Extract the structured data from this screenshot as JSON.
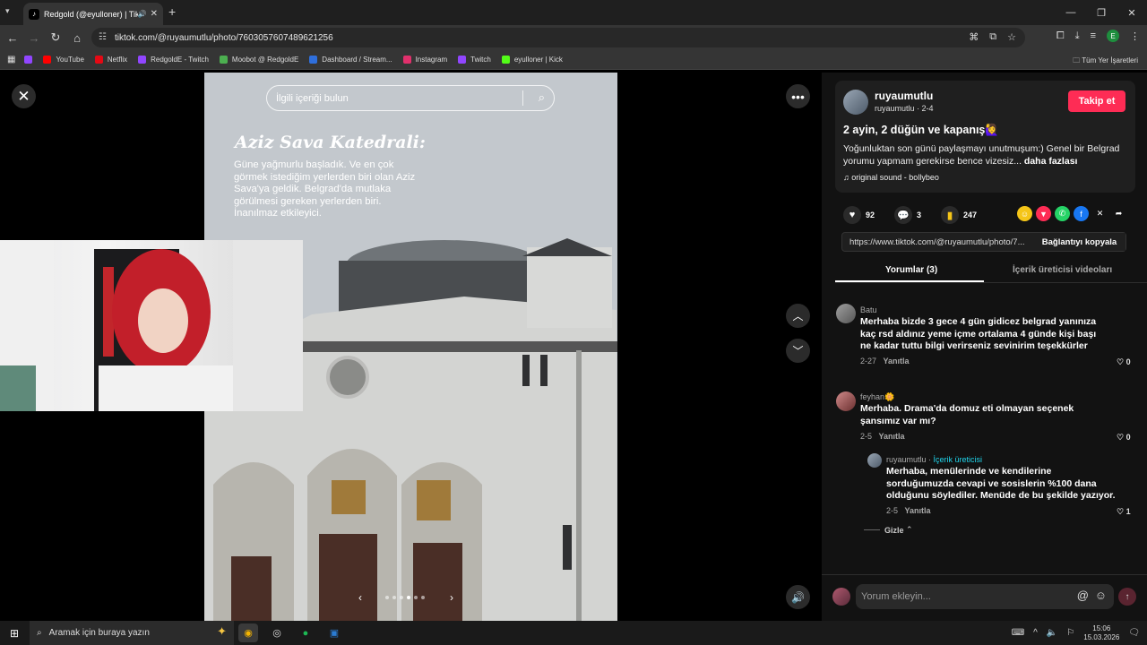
{
  "browser": {
    "tab_title": "Redgold (@eyulloner) | Tik",
    "url": "tiktok.com/@ruyaumutlu/photo/7603057607489621256",
    "profile_initial": "E",
    "bookmarks": [
      {
        "label": "YouTube",
        "color": "#ff0000"
      },
      {
        "label": "Netflix",
        "color": "#e50914"
      },
      {
        "label": "RedgoldE - Twitch",
        "color": "#9146ff"
      },
      {
        "label": "Moobot @ RedgoldE",
        "color": "#4caf50"
      },
      {
        "label": "Dashboard / Stream...",
        "color": "#2f6fdc"
      },
      {
        "label": "Instagram",
        "color": "#e1306c"
      },
      {
        "label": "Twitch",
        "color": "#9146ff"
      },
      {
        "label": "eyulloner | Kick",
        "color": "#53fc18"
      }
    ],
    "bookmarks_all": "Tüm Yer İşaretleri"
  },
  "viewer": {
    "search_placeholder": "İlgili içeriği bulun",
    "caption_title": "Aziz Sava Katedrali:",
    "caption_body": "Güne yağmurlu başladık. Ve en çok görmek istediğim yerlerden biri olan Aziz Sava'ya geldik. Belgrad'da mutlaka görülmesi gereken yerlerden biri. İnanılmaz etkileyici.",
    "slide_count": 6,
    "active_slide": 4
  },
  "post": {
    "username": "ruyaumutlu",
    "subline": "ruyaumutlu · 2-4",
    "follow_label": "Takip et",
    "title": "2 ayin, 2 düğün ve kapanış🙋‍♀️",
    "description": "Yoğunluktan son günü paylaşmayı unutmuşum:) Genel bir Belgrad yorumu yapmam gerekirse bence vizesiz...",
    "more_label": "daha fazlası",
    "sound": "original sound - bollybeo",
    "likes": "92",
    "comments": "3",
    "saves": "247",
    "link": "https://www.tiktok.com/@ruyaumutlu/photo/7...",
    "copy_label": "Bağlantıyı kopyala",
    "tab_comments": "Yorumlar (3)",
    "tab_creator_videos": "İçerik üreticisi videoları"
  },
  "comments": [
    {
      "name": "Batu",
      "text": "Merhaba bizde 3 gece 4 gün gidicez belgrad yanınıza kaç rsd aldınız yeme içme ortalama 4 günde kişi başı ne kadar tuttu bilgi verirseniz sevinirim teşekkürler",
      "date": "2-27",
      "reply": "Yanıtla",
      "likes": "0"
    },
    {
      "name": "feyhan🌼",
      "text": "Merhaba. Drama'da domuz eti olmayan seçenek şansımız var mı?",
      "date": "2-5",
      "reply": "Yanıtla",
      "likes": "0"
    },
    {
      "name": "ruyaumutlu",
      "badge": "İçerik üreticisi",
      "text": "Merhaba, menülerinde ve kendilerine sorduğumuzda cevapi ve sosislerin %100 dana olduğunu söylediler. Menüde de bu şekilde yazıyor.",
      "date": "2-5",
      "reply": "Yanıtla",
      "likes": "1"
    }
  ],
  "hide_label": "Gizle",
  "comment_placeholder": "Yorum ekleyin...",
  "taskbar": {
    "search_placeholder": "Aramak için buraya yazın",
    "time": "15:06",
    "date": "15.03.2026"
  },
  "colors": {
    "accent": "#fe2c55",
    "creator_badge": "#20d5ec"
  }
}
